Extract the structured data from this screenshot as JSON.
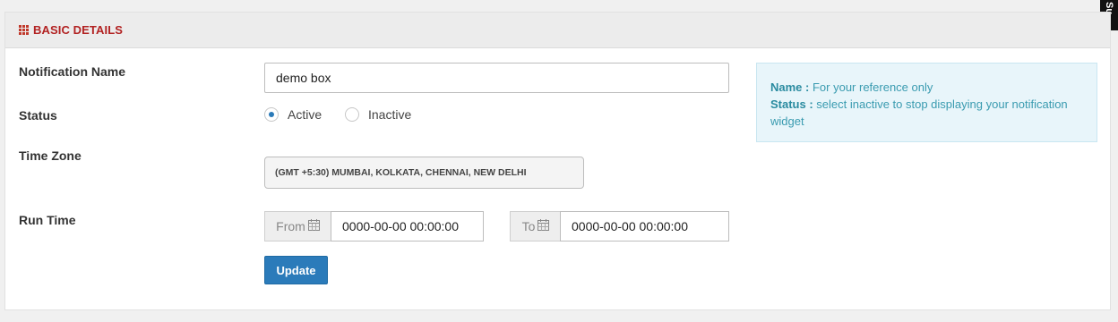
{
  "panel": {
    "title": "BASIC DETAILS"
  },
  "form": {
    "notification_name": {
      "label": "Notification Name",
      "value": "demo box"
    },
    "status": {
      "label": "Status",
      "options": [
        {
          "label": "Active",
          "checked": true
        },
        {
          "label": "Inactive",
          "checked": false
        }
      ]
    },
    "time_zone": {
      "label": "Time Zone",
      "value": "(GMT +5:30) MUMBAI, KOLKATA, CHENNAI, NEW DELHI"
    },
    "run_time": {
      "label": "Run Time",
      "from_label": "From",
      "from_value": "0000-00-00 00:00:00",
      "to_label": "To",
      "to_value": "0000-00-00 00:00:00"
    },
    "update_label": "Update"
  },
  "info": {
    "name_key": "Name :",
    "name_text": " For your reference only",
    "status_key": "Status :",
    "status_text": " select inactive to stop displaying your notification widget"
  },
  "side_tab": {
    "label": "Su"
  },
  "colors": {
    "accent": "#2b7bba",
    "header_title": "#b22222",
    "info_text": "#3a9bb0"
  }
}
